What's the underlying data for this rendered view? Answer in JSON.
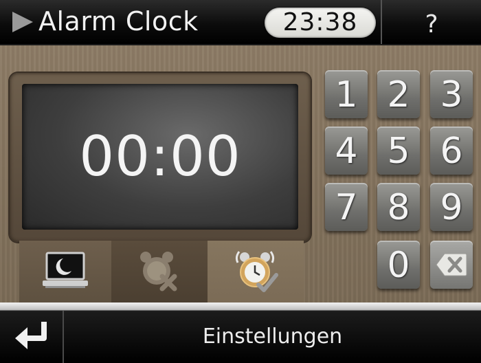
{
  "header": {
    "title": "Alarm Clock",
    "current_time": "23:38",
    "help_label": "?"
  },
  "display": {
    "alarm_time": "00:00"
  },
  "keypad": {
    "keys": [
      "1",
      "2",
      "3",
      "4",
      "5",
      "6",
      "7",
      "8",
      "9",
      "0"
    ],
    "backspace_icon": "backspace-x-icon"
  },
  "mode_tabs": [
    {
      "icon": "sleep-mode-moon-laptop-icon",
      "state": "normal"
    },
    {
      "icon": "alarm-off-icon",
      "state": "selected"
    },
    {
      "icon": "alarm-on-check-icon",
      "state": "normal"
    }
  ],
  "footer": {
    "back_icon": "return-arrow-icon",
    "settings_label": "Einstellungen"
  },
  "colors": {
    "title_bar": "#000000",
    "wood": "#7b6b56",
    "key": "#6f6f6c",
    "text": "#f4f4f4"
  }
}
